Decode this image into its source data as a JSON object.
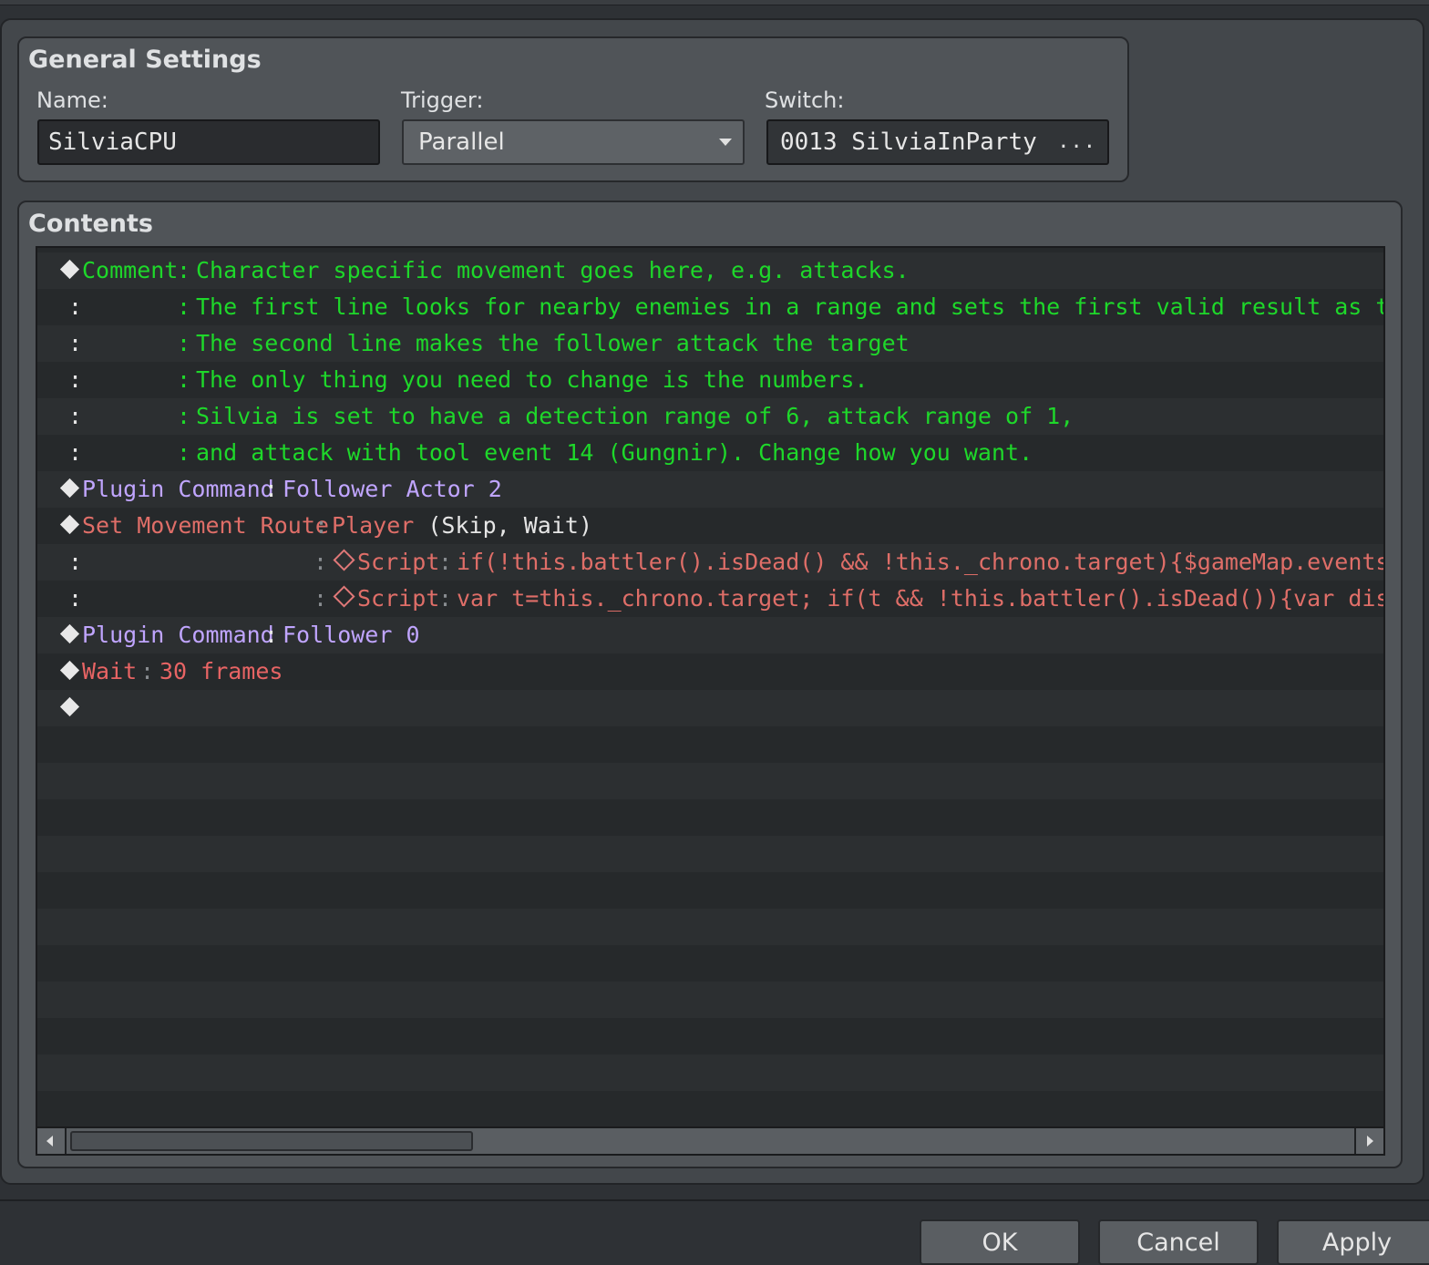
{
  "general": {
    "title": "General Settings",
    "name_label": "Name:",
    "name_value": "SilviaCPU",
    "trigger_label": "Trigger:",
    "trigger_value": "Parallel",
    "switch_label": "Switch:",
    "switch_value": "0013 SilviaInParty",
    "switch_button": "..."
  },
  "contents": {
    "title": "Contents",
    "rows": [
      {
        "cmd": "Comment",
        "sep": ":",
        "text": "Character specific movement goes here, e.g. attacks."
      },
      {
        "lead": ":",
        "sep": ":",
        "text": "The first line looks for nearby enemies in a range and sets the first valid result as the target"
      },
      {
        "lead": ":",
        "sep": ":",
        "text": "The second line makes the follower attack the target"
      },
      {
        "lead": ":",
        "sep": ":",
        "text": "The only thing you need to change is the numbers."
      },
      {
        "lead": ":",
        "sep": ":",
        "text": "Silvia is set to have a detection range of 6, attack range of 1,"
      },
      {
        "lead": ":",
        "sep": ":",
        "text": "and attack with tool event 14 (Gungnir). Change how you want."
      },
      {
        "cmd": "Plugin Command",
        "sep": ":",
        "text": "Follower Actor 2"
      },
      {
        "cmd": "Set Movement Route",
        "sep": ":",
        "target": "Player",
        "opts": "(Skip, Wait)"
      },
      {
        "lead": ":",
        "sep": ":",
        "sub": "Script",
        "sep2": ":",
        "text": "if(!this.battler().isDead() && !this._chrono.target){$gameMap.events().forE"
      },
      {
        "lead": ":",
        "sep": ":",
        "sub": "Script",
        "sep2": ":",
        "text": "var t=this._chrono.target; if(t && !this.battler().isDead()){var dist= this"
      },
      {
        "cmd": "Plugin Command",
        "sep": ":",
        "text": "Follower 0"
      },
      {
        "cmd": "Wait",
        "sep": ":",
        "text": "30 frames"
      }
    ]
  },
  "buttons": {
    "ok": "OK",
    "cancel": "Cancel",
    "apply": "Apply"
  }
}
